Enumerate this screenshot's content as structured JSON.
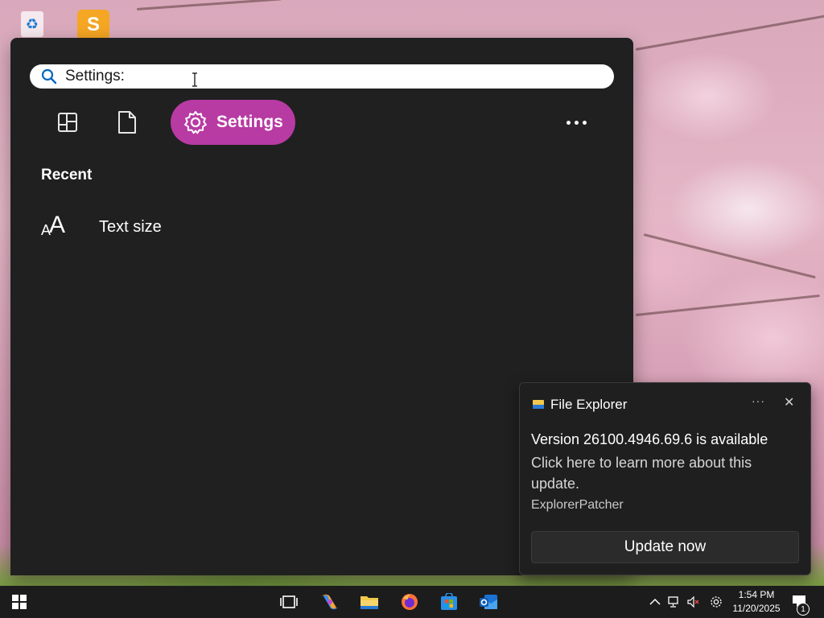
{
  "search": {
    "value": "Settings:",
    "placeholder": ""
  },
  "filters": {
    "active_label": "Settings",
    "items": [
      "apps-icon",
      "documents-icon",
      "settings-icon"
    ]
  },
  "recent": {
    "title": "Recent",
    "items": [
      {
        "icon": "text-size-icon",
        "label": "Text size"
      }
    ]
  },
  "toast": {
    "app_name": "File Explorer",
    "title": "Version 26100.4946.69.6 is available",
    "body": "Click here to learn more about this update.",
    "source": "ExplorerPatcher",
    "button_label": "Update now"
  },
  "taskbar": {
    "time": "1:54 PM",
    "date": "11/20/2025",
    "notification_count": "1",
    "pinned": [
      "start-icon",
      "task-view-icon",
      "copilot-icon",
      "file-explorer-icon",
      "firefox-icon",
      "microsoft-store-icon",
      "outlook-icon"
    ]
  },
  "colors": {
    "accent": "#b83aa3",
    "flyout_bg": "#202020",
    "taskbar_bg": "#1c1c1c"
  }
}
